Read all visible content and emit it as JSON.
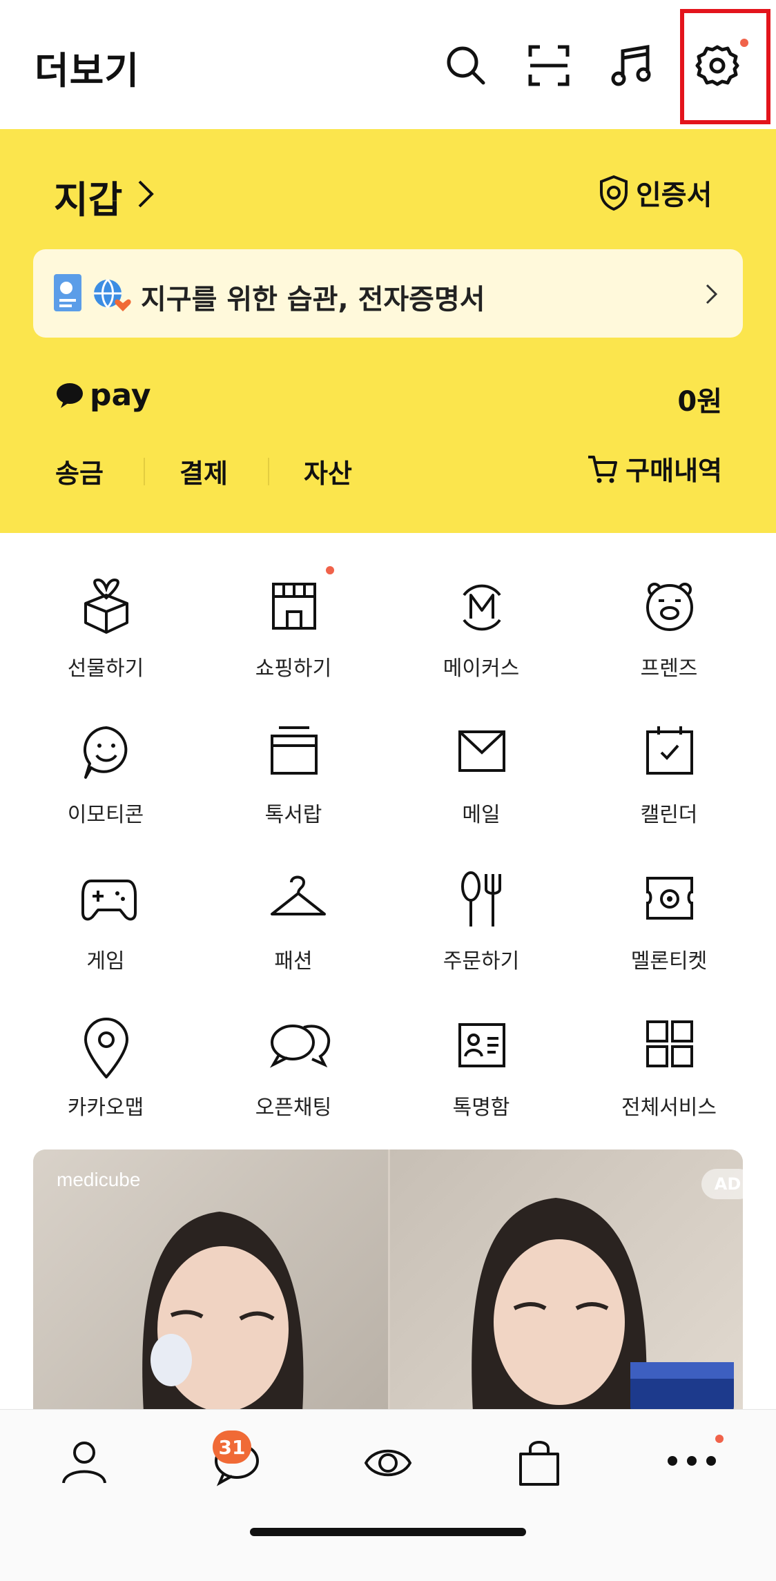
{
  "header": {
    "title": "더보기"
  },
  "wallet": {
    "title": "지갑",
    "certificate_label": "인증서",
    "banner_text": "지구를 위한 습관, 전자증명서",
    "pay_label": "pay",
    "balance": "0원",
    "tabs": [
      "송금",
      "결제",
      "자산"
    ],
    "purchase_history": "구매내역"
  },
  "services": [
    {
      "label": "선물하기",
      "icon": "gift-icon"
    },
    {
      "label": "쇼핑하기",
      "icon": "shop-icon"
    },
    {
      "label": "메이커스",
      "icon": "makers-icon"
    },
    {
      "label": "프렌즈",
      "icon": "friends-bear-icon"
    },
    {
      "label": "이모티콘",
      "icon": "emoticon-icon"
    },
    {
      "label": "톡서랍",
      "icon": "drawer-icon"
    },
    {
      "label": "메일",
      "icon": "mail-icon"
    },
    {
      "label": "캘린더",
      "icon": "calendar-icon"
    },
    {
      "label": "게임",
      "icon": "gamepad-icon"
    },
    {
      "label": "패션",
      "icon": "hanger-icon"
    },
    {
      "label": "주문하기",
      "icon": "fork-knife-icon"
    },
    {
      "label": "멜론티켓",
      "icon": "ticket-icon"
    },
    {
      "label": "카카오맵",
      "icon": "map-pin-icon"
    },
    {
      "label": "오픈채팅",
      "icon": "open-chat-icon"
    },
    {
      "label": "톡명함",
      "icon": "business-card-icon"
    },
    {
      "label": "전체서비스",
      "icon": "grid-icon"
    }
  ],
  "ad": {
    "brand": "medicube",
    "badge": "AD"
  },
  "bottom_nav": {
    "chat_badge": "31"
  },
  "colors": {
    "wallet_bg": "#fbe54d",
    "highlight": "#e3141c",
    "badge": "#f06a36",
    "dot": "#f0624a"
  }
}
